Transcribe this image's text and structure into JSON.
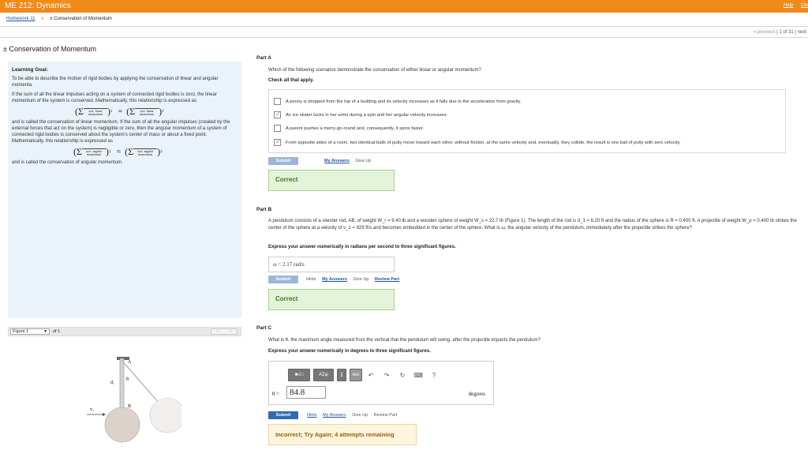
{
  "app": {
    "title": "ME 212: Dynamics",
    "links": [
      "Help",
      "Clo"
    ]
  },
  "breadcrumb": {
    "homework": "Homework 11",
    "separator": "»",
    "current": "± Conservation of Momentum"
  },
  "pager": {
    "prev": "« previous",
    "sep": "|",
    "page": "1 of 31",
    "next": "next"
  },
  "page_title": "± Conservation of Momentum",
  "learning_goal": {
    "title": "Learning Goal:",
    "intro": "To be able to describe the motion of rigid bodies by applying the conservation of linear and angular momenta.",
    "p1": "If the sum of all the linear impulses acting on a system of connected rigid bodies is zero, the linear momentum of the system is conserved. Mathematically, this relationship is expressed as",
    "eq1_term": "syst. linear momentum",
    "p2": "and is called the conservation of linear momentum. If the sum of all the angular impulses (created by the external forces that act on the system) is negligible or zero, then the angular momentum of a system of connected rigid bodies is conserved about the system's center of mass or about a fixed point. Mathematically, this relationship is expressed as",
    "eq2_term": "syst. angular momentum",
    "p3": "and is called the conservation of angular momentum."
  },
  "figure": {
    "label": "Figure 1",
    "of": "of 1",
    "nav_prev": "<",
    "nav_next": ">",
    "labels": {
      "A": "A",
      "B": "B",
      "d1": "d₁",
      "theta": "θ",
      "v1": "v₁"
    }
  },
  "part_a": {
    "label": "Part A",
    "question": "Which of the following scenarios demonstrate the conservation of either linear or angular momentum?",
    "instruction": "Check all that apply.",
    "choices": [
      {
        "text": "A penny is dropped from the top of a building and its velocity increases as it falls due to the acceleration from gravity.",
        "checked": false
      },
      {
        "text": "An ice skater tucks in her arms during a spin and her angular velocity increases.",
        "checked": true
      },
      {
        "text": "A parent pushes a merry-go-round and, consequently, it spins faster.",
        "checked": false
      },
      {
        "text": "From opposite sides of a room, two identical balls of putty move toward each other, without friction, at the same velocity and, eventually, they collide; the result is one ball of putty with zero velocity.",
        "checked": true
      }
    ],
    "submit": "Submit",
    "my_answers": "My Answers",
    "give_up": "Give Up",
    "feedback": "Correct"
  },
  "part_b": {
    "label": "Part B",
    "question": "A pendulum consists of a slender rod, AB, of weight W_r = 9.40 lb and a wooden sphere of weight W_s = 22.7 lb (Figure 1). The length of the rod is d_1 = 6.20 ft and the radius of the sphere is R = 0.400 ft. A projectile of weight W_p = 0.400 lb strikes the center of the sphere at a velocity of v_1 = 929 ft/s and becomes embedded in the center of the sphere. What is ω, the angular velocity of the pendulum, immediately after the projectile strikes the sphere?",
    "instruction": "Express your answer numerically in radians per second to three significant figures.",
    "answer": "ω = 2.17 rad/s",
    "submit": "Submit",
    "hints": "Hints",
    "my_answers": "My Answers",
    "give_up": "Give Up",
    "review": "Review Part",
    "feedback": "Correct"
  },
  "part_c": {
    "label": "Part C",
    "question": "What is θ, the maximum angle measured from the vertical that the pendulum will swing, after the projectile impacts the pendulum?",
    "instruction": "Express your answer numerically in degrees to three significant figures.",
    "toolbar": {
      "templates": "■√□",
      "symbols": "ΑΣφ",
      "vec": "vec",
      "help": "?"
    },
    "var_label": "θ =",
    "value": "84.8",
    "unit": "degrees",
    "submit": "Submit",
    "hints": "Hints",
    "my_answers": "My Answers",
    "give_up": "Give Up",
    "review": "Review Part",
    "feedback": "Incorrect; Try Again; 4 attempts remaining"
  },
  "colors": {
    "topbar": "#ef8a1b",
    "panel": "#eaf2fa",
    "correct_bg": "#e3f4da",
    "incorrect_bg": "#fdf5de",
    "submit_active": "#2f6ab3"
  }
}
